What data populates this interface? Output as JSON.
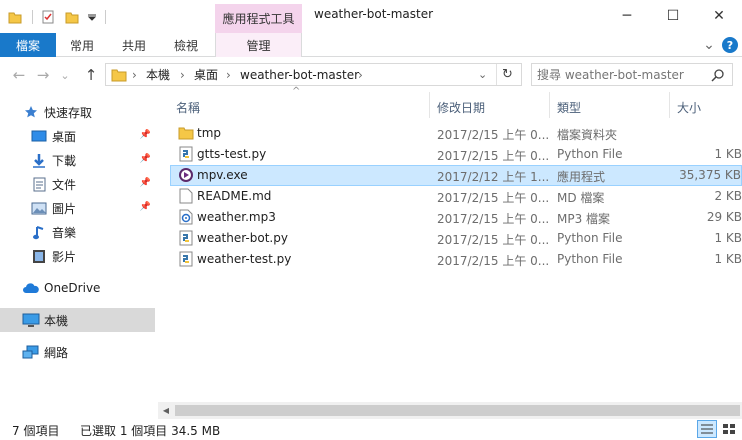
{
  "window": {
    "title": "weather-bot-master",
    "contextual_tab_group": "應用程式工具",
    "minimize_glyph": "─",
    "maximize_glyph": "☐",
    "close_glyph": "✕"
  },
  "ribbon": {
    "tabs": [
      "檔案",
      "常用",
      "共用",
      "檢視",
      "管理"
    ],
    "collapse_glyph": "⌄",
    "help_glyph": "?"
  },
  "nav": {
    "back": "←",
    "forward": "→",
    "recent": "⌄",
    "up": "↑",
    "path_sep": "›",
    "breadcrumbs": [
      "本機",
      "桌面",
      "weather-bot-master"
    ],
    "refresh": "↻",
    "dropdown": "⌄"
  },
  "search": {
    "placeholder": "搜尋 weather-bot-master",
    "icon": "search-icon"
  },
  "sidebar": {
    "items": [
      {
        "label": "快速存取",
        "icon": "star-icon"
      },
      {
        "label": "桌面",
        "icon": "desktop-icon",
        "pinned": true
      },
      {
        "label": "下載",
        "icon": "download-icon",
        "pinned": true
      },
      {
        "label": "文件",
        "icon": "document-icon",
        "pinned": true
      },
      {
        "label": "圖片",
        "icon": "picture-icon",
        "pinned": true
      },
      {
        "label": "音樂",
        "icon": "music-icon"
      },
      {
        "label": "影片",
        "icon": "video-icon"
      },
      {
        "label": "OneDrive",
        "icon": "cloud-icon"
      },
      {
        "label": "本機",
        "icon": "computer-icon",
        "active": true
      },
      {
        "label": "網路",
        "icon": "network-icon"
      }
    ]
  },
  "columns": {
    "name": "名稱",
    "date": "修改日期",
    "type": "類型",
    "size": "大小",
    "sort_indicator": "^"
  },
  "files": [
    {
      "name": "tmp",
      "date": "2017/2/15 上午 0...",
      "type": "檔案資料夾",
      "size": "",
      "icon": "folder-icon"
    },
    {
      "name": "gtts-test.py",
      "date": "2017/2/15 上午 0...",
      "type": "Python File",
      "size": "1 KB",
      "icon": "python-file-icon"
    },
    {
      "name": "mpv.exe",
      "date": "2017/2/12 上午 1...",
      "type": "應用程式",
      "size": "35,375 KB",
      "icon": "mpv-app-icon",
      "selected": true
    },
    {
      "name": "README.md",
      "date": "2017/2/15 上午 0...",
      "type": "MD 檔案",
      "size": "2 KB",
      "icon": "text-file-icon"
    },
    {
      "name": "weather.mp3",
      "date": "2017/2/15 上午 0...",
      "type": "MP3 檔案",
      "size": "29 KB",
      "icon": "audio-file-icon"
    },
    {
      "name": "weather-bot.py",
      "date": "2017/2/15 上午 0...",
      "type": "Python File",
      "size": "1 KB",
      "icon": "python-file-icon"
    },
    {
      "name": "weather-test.py",
      "date": "2017/2/15 上午 0...",
      "type": "Python File",
      "size": "1 KB",
      "icon": "python-file-icon"
    }
  ],
  "status": {
    "count": "7 個項目",
    "selection": "已選取 1 個項目 34.5 MB"
  },
  "colors": {
    "file_tab": "#1979ca",
    "context_tab": "#f4d4ec",
    "selected_row": "#cce8ff",
    "folder": "#f5c747",
    "accent": "#1979ca"
  }
}
